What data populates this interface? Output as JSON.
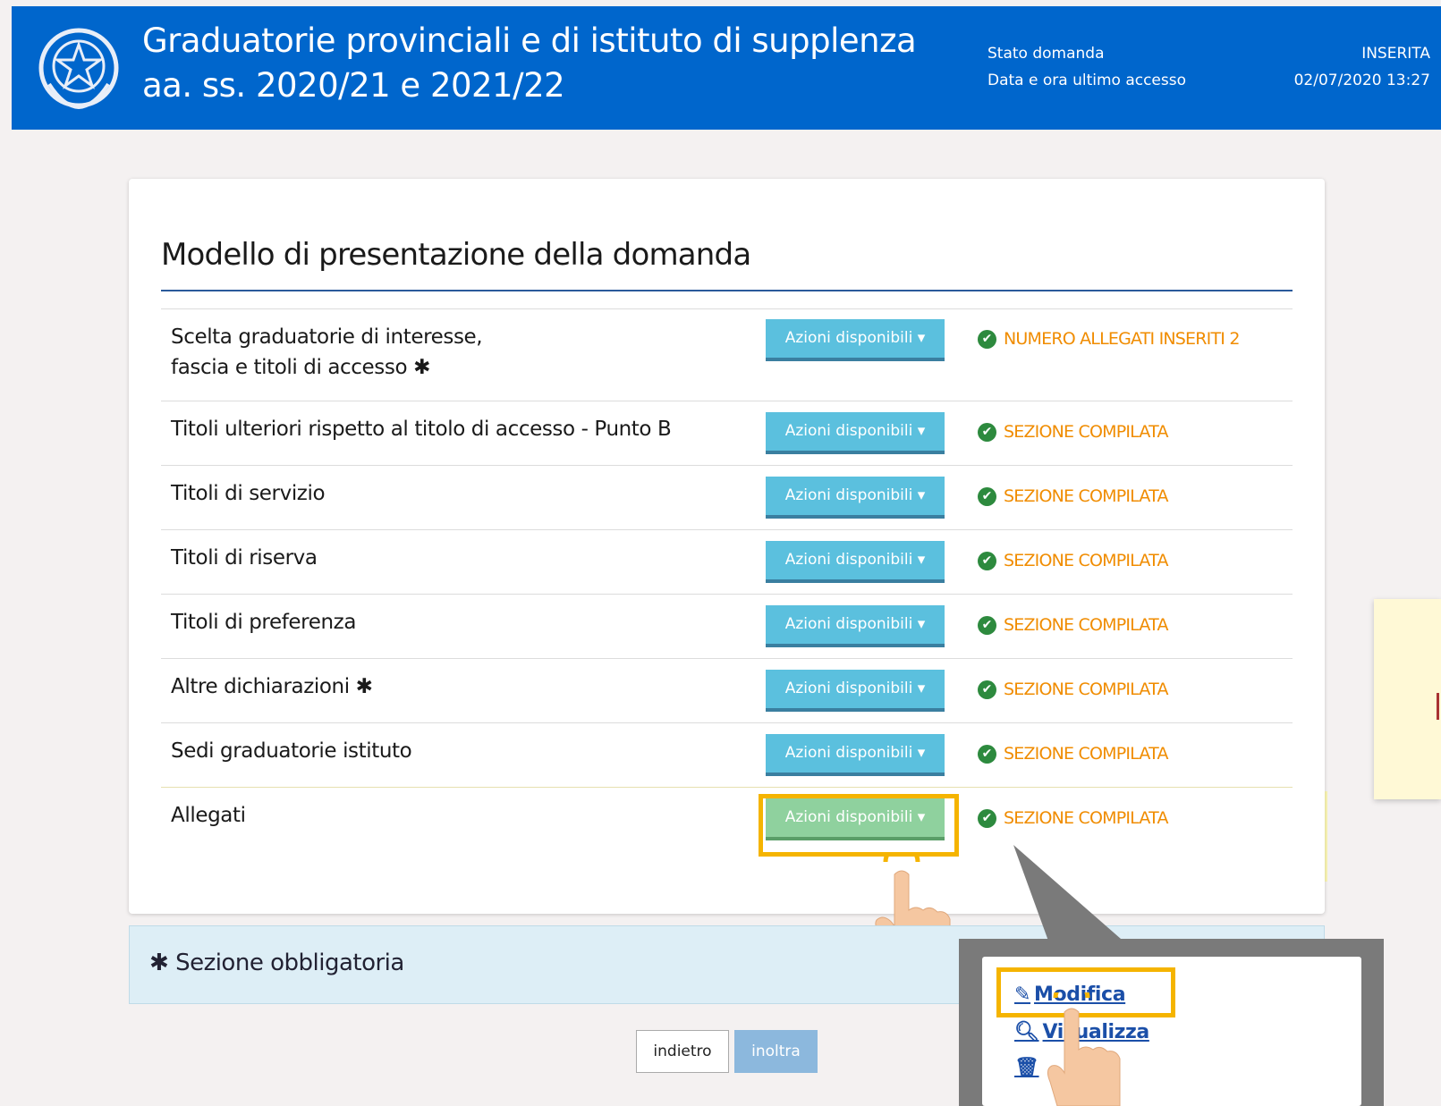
{
  "header": {
    "title_line1": "Graduatorie provinciali e di istituto di supplenza",
    "title_line2": "aa. ss. 2020/21 e 2021/22",
    "status_label": "Stato domanda",
    "status_value": "INSERITA",
    "access_label": "Data e ora ultimo accesso",
    "access_value": "02/07/2020 13:27"
  },
  "card": {
    "title": "Modello di presentazione della domanda",
    "action_label": "Azioni disponibili ▾",
    "rows": [
      {
        "label_line1": "Scelta graduatorie di interesse,",
        "label_line2": "fascia e titoli di accesso",
        "mandatory": true,
        "status": "NUMERO ALLEGATI INSERITI 2"
      },
      {
        "label_line1": "Titoli ulteriori rispetto al titolo di accesso - Punto B",
        "mandatory": false,
        "status": "SEZIONE COMPILATA"
      },
      {
        "label_line1": "Titoli di servizio",
        "mandatory": false,
        "status": "SEZIONE COMPILATA"
      },
      {
        "label_line1": "Titoli di riserva",
        "mandatory": false,
        "status": "SEZIONE COMPILATA"
      },
      {
        "label_line1": "Titoli di preferenza",
        "mandatory": false,
        "status": "SEZIONE COMPILATA"
      },
      {
        "label_line1": "Altre dichiarazioni",
        "mandatory": true,
        "status": "SEZIONE COMPILATA"
      },
      {
        "label_line1": "Sedi graduatorie istituto",
        "mandatory": false,
        "status": "SEZIONE COMPILATA"
      },
      {
        "label_line1": "Allegati",
        "mandatory": false,
        "status": "SEZIONE COMPILATA"
      }
    ]
  },
  "legend": {
    "star": "✱",
    "text": "Sezione obbligatoria"
  },
  "buttons": {
    "back": "indietro",
    "forward": "inoltra"
  },
  "dropdown": {
    "items": [
      {
        "label": "Modifica",
        "icon": "edit-icon"
      },
      {
        "label": "Visualizza",
        "icon": "search-icon"
      },
      {
        "label": "",
        "icon": "trash-icon"
      }
    ]
  },
  "colors": {
    "header": "#0066cc",
    "action_button": "#5bc0de",
    "highlighted_button": "#8fd19e",
    "status": "#f08c00",
    "highlight": "#f5b400"
  }
}
